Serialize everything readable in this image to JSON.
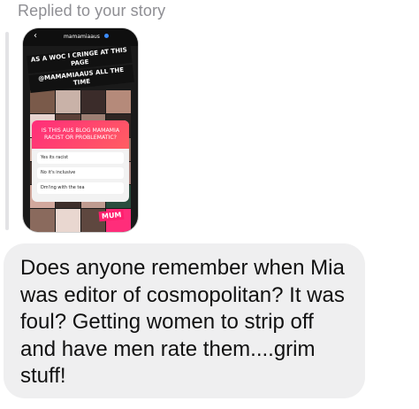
{
  "header": {
    "replied_label": "Replied to your story"
  },
  "story": {
    "handle": "mamamiaaus",
    "back_glyph": "‹",
    "caption_lines": [
      "AS A WOC I CRINGE AT THIS PAGE",
      "@MAMAMIAAUS ALL THE TIME"
    ],
    "poll": {
      "question": "IS THIS AUS BLOG MAMAMIA RACIST OR PROBLEMATIC?",
      "options": [
        "Yes its racist",
        "No it's inclusive",
        "Dm'ing with the tea"
      ]
    },
    "logo_text": "MUM",
    "accent_color": "#ff2d7a"
  },
  "message": {
    "text": "Does anyone remember when Mia was editor of cosmopolitan? It was foul? Getting women to strip off and have men rate them....grim stuff!"
  }
}
